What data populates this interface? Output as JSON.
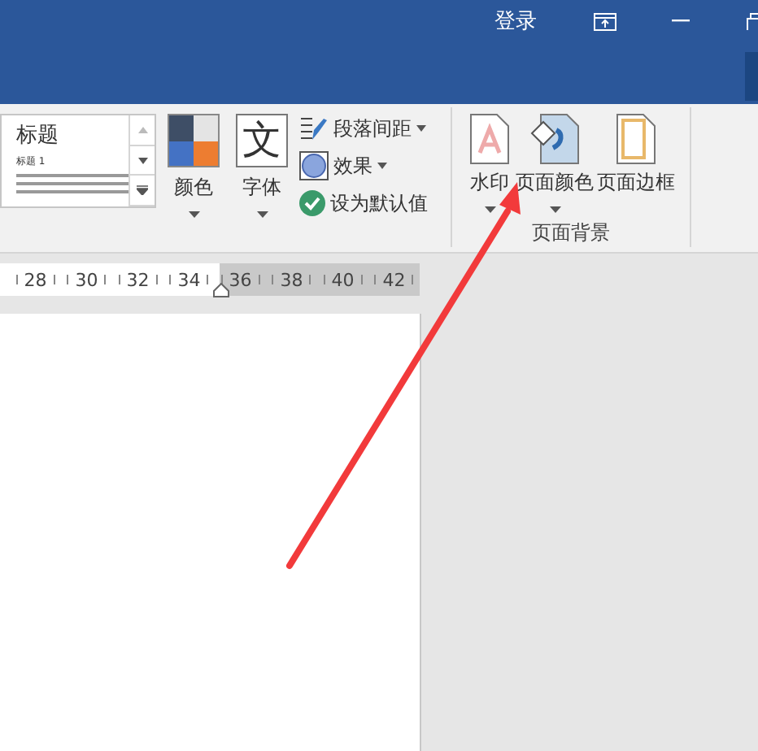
{
  "title_bar": {
    "sign_in": "登录"
  },
  "ribbon": {
    "style_gallery": {
      "title": "标题",
      "heading": "标题 1"
    },
    "colors": {
      "label": "颜色",
      "dropdown": true
    },
    "fonts": {
      "label": "字体",
      "glyph": "文",
      "dropdown": true
    },
    "options": [
      {
        "kind": "spacing",
        "label": "段落间距",
        "dropdown": true
      },
      {
        "kind": "effects",
        "label": "效果",
        "dropdown": true
      },
      {
        "kind": "default",
        "label": "设为默认值",
        "dropdown": false
      }
    ],
    "page_background": {
      "group_label": "页面背景",
      "buttons": [
        {
          "kind": "watermark",
          "label": "水印",
          "dropdown": true
        },
        {
          "kind": "page_color",
          "label": "页面颜色",
          "dropdown": true
        },
        {
          "kind": "page_border",
          "label": "页面边框",
          "dropdown": false
        }
      ]
    }
  },
  "ruler": {
    "numbers": [
      "28",
      "30",
      "32",
      "34",
      "36",
      "38",
      "40",
      "42"
    ]
  },
  "annotation": {
    "kind": "arrow"
  }
}
